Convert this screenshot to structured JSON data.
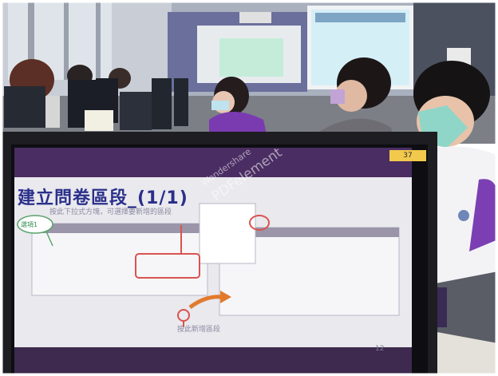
{
  "slide": {
    "title": "建立問卷區段_(1/1)",
    "subtitle": "按此下拉式方塊，可選擇要新增的區段",
    "bubble_label": "選項1",
    "bottom_note": "按此新增區段",
    "page_number": "12"
  },
  "monitor_tag": "37",
  "watermark": {
    "line1": "Wondershare",
    "line2": "PDFelement"
  }
}
